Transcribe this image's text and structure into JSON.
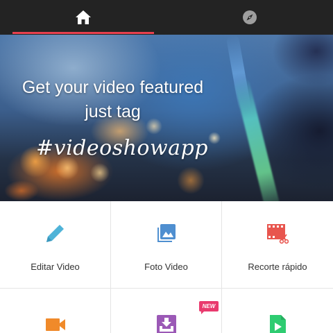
{
  "tabs": [
    {
      "name": "home",
      "icon": "home-icon",
      "selected": true
    },
    {
      "name": "explore",
      "icon": "compass-icon",
      "selected": false
    }
  ],
  "colors": {
    "topbar": "#232323",
    "tab_indicator": "#e8414f",
    "badge": "#e93a6e"
  },
  "banner": {
    "line1": "Get your video featured",
    "line2": "just tag",
    "hashtag": "#videoshowapp"
  },
  "tools": [
    {
      "label": "Editar Video",
      "icon": "pencil-icon",
      "color": "#4fb3d8"
    },
    {
      "label": "Foto Video",
      "icon": "photo-icon",
      "color": "#4f8fd0"
    },
    {
      "label": "Recorte rápido",
      "icon": "film-scissors-icon",
      "color": "#e8554e"
    },
    {
      "label": "",
      "icon": "video-camera-icon",
      "color": "#f08a2a"
    },
    {
      "label": "",
      "icon": "download-tray-icon",
      "color": "#9b59b6",
      "badge": "NEW"
    },
    {
      "label": "",
      "icon": "play-file-icon",
      "color": "#2ecc71"
    }
  ]
}
